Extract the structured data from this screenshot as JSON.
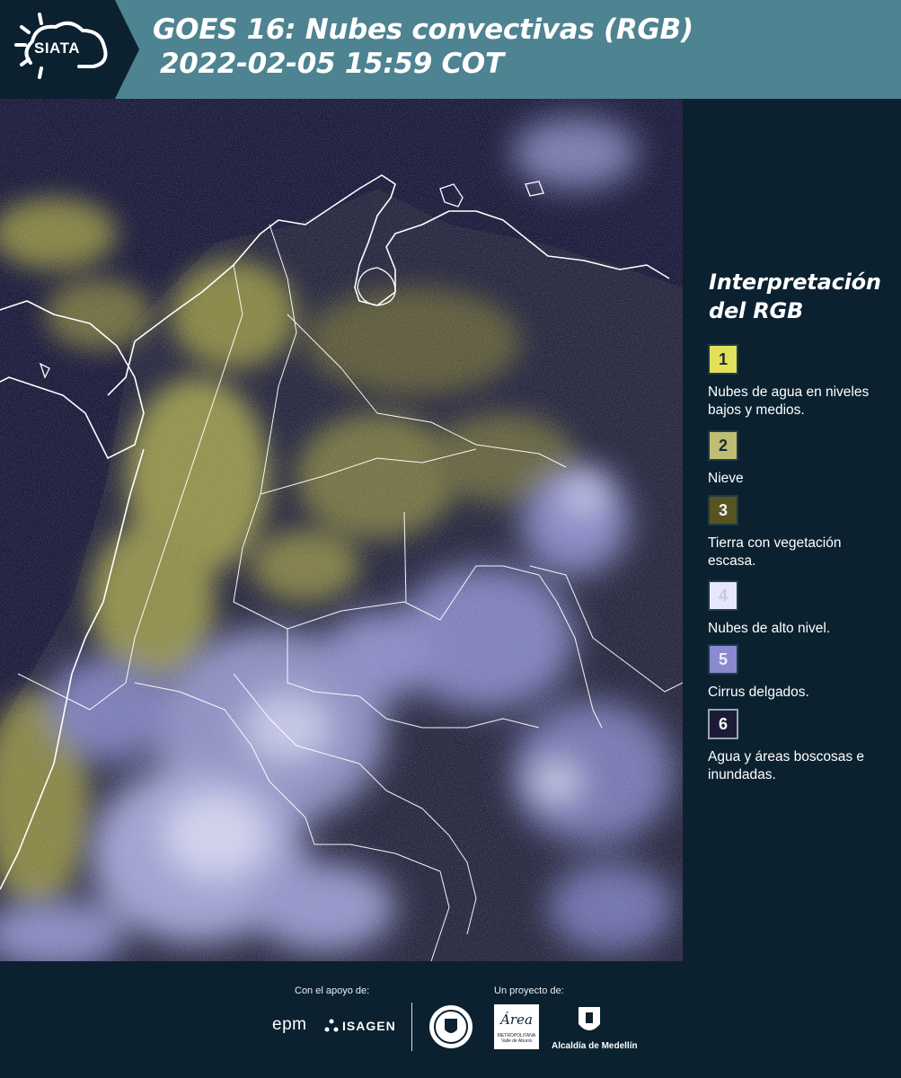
{
  "brand": {
    "logo_text": "SIATA"
  },
  "header": {
    "title_line1": "GOES 16: Nubes convectivas (RGB)",
    "title_line2": "2022-02-05 15:59 COT"
  },
  "legend": {
    "title_line1": "Interpretación",
    "title_line2": "del RGB",
    "items": [
      {
        "number": "1",
        "color": "#e3e15c",
        "label": "Nubes de agua en niveles bajos y medios."
      },
      {
        "number": "2",
        "color": "#bfbd74",
        "label": "Nieve"
      },
      {
        "number": "3",
        "color": "#575420",
        "label": "Tierra con vegetación escasa."
      },
      {
        "number": "4",
        "color": "#e6e7fb",
        "label": "Nubes de alto nivel."
      },
      {
        "number": "5",
        "color": "#8b89cf",
        "label": "Cirrus delgados."
      },
      {
        "number": "6",
        "color": "#1c1b37",
        "label": "Agua y áreas boscosas e inundadas."
      }
    ]
  },
  "footer": {
    "support_label": "Con el apoyo de:",
    "project_label": "Un proyecto de:",
    "sponsors": [
      "epm",
      "ISAGEN"
    ],
    "partners": [
      "Alcaldía de Medellín"
    ],
    "area_logo": {
      "word": "Área",
      "line1": "METROPOLITANA",
      "line2": "Valle de Aburrá"
    }
  },
  "colors": {
    "header_bg": "#4e8391",
    "logo_bg": "#0b2130",
    "page_bg": "#0b2130",
    "map_ocean": "#1a1a3e",
    "low_cloud": "#c9c65e",
    "high_cloud": "#c6c8f5"
  }
}
